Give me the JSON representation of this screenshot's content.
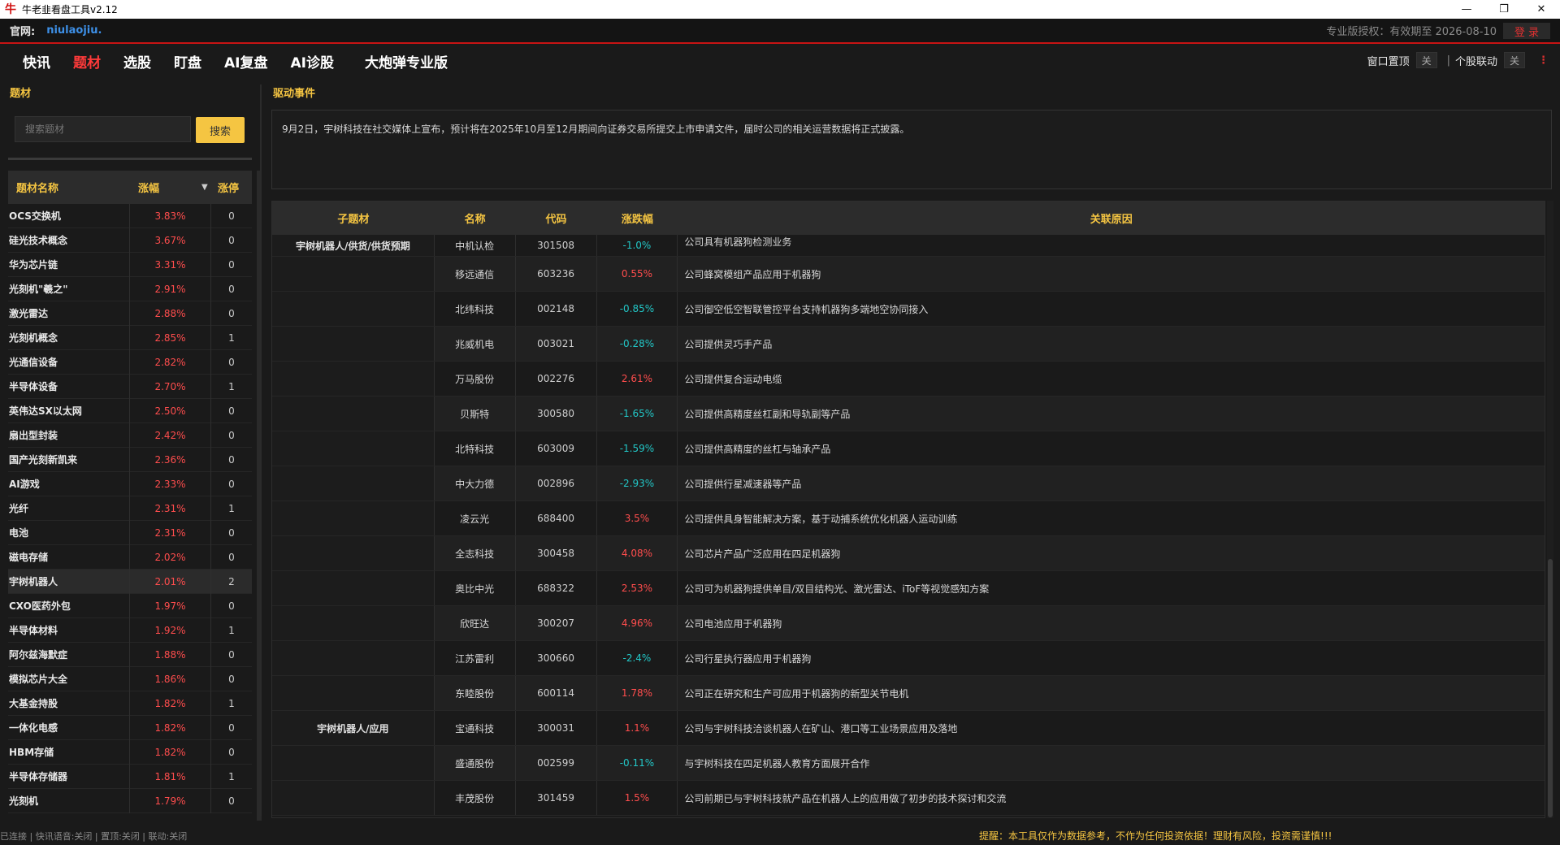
{
  "window": {
    "title": "牛老韭看盘工具v2.12",
    "app_icon": "牛"
  },
  "site": {
    "label": "官网:",
    "url": "niulaojiu.",
    "license": "专业版授权：有效期至 2026-08-10",
    "login": "登 录"
  },
  "nav": {
    "tabs": [
      "快讯",
      "题材",
      "选股",
      "盯盘",
      "AI复盘",
      "AI诊股",
      "大炮弹专业版"
    ],
    "active_index": 1,
    "window_top_label": "窗口置顶",
    "window_top_state": "关",
    "separator": "|",
    "stock_link_label": "个股联动",
    "stock_link_state": "关"
  },
  "left": {
    "header": "题材",
    "search_placeholder": "搜索题材",
    "search_button": "搜索",
    "columns": [
      "题材名称",
      "涨幅",
      "涨停"
    ],
    "sort_icon": "▼",
    "selected_index": 15,
    "rows": [
      {
        "name": "OCS交换机",
        "change": "3.83%",
        "limit_up": "0"
      },
      {
        "name": "硅光技术概念",
        "change": "3.67%",
        "limit_up": "0"
      },
      {
        "name": "华为芯片链",
        "change": "3.31%",
        "limit_up": "0"
      },
      {
        "name": "光刻机\"羲之\"",
        "change": "2.91%",
        "limit_up": "0"
      },
      {
        "name": "激光雷达",
        "change": "2.88%",
        "limit_up": "0"
      },
      {
        "name": "光刻机概念",
        "change": "2.85%",
        "limit_up": "1"
      },
      {
        "name": "光通信设备",
        "change": "2.82%",
        "limit_up": "0"
      },
      {
        "name": "半导体设备",
        "change": "2.70%",
        "limit_up": "1"
      },
      {
        "name": "英伟达SX以太网",
        "change": "2.50%",
        "limit_up": "0"
      },
      {
        "name": "扇出型封装",
        "change": "2.42%",
        "limit_up": "0"
      },
      {
        "name": "国产光刻新凯来",
        "change": "2.36%",
        "limit_up": "0"
      },
      {
        "name": "AI游戏",
        "change": "2.33%",
        "limit_up": "0"
      },
      {
        "name": "光纤",
        "change": "2.31%",
        "limit_up": "1"
      },
      {
        "name": "电池",
        "change": "2.31%",
        "limit_up": "0"
      },
      {
        "name": "磁电存储",
        "change": "2.02%",
        "limit_up": "0"
      },
      {
        "name": "宇树机器人",
        "change": "2.01%",
        "limit_up": "2"
      },
      {
        "name": "CXO医药外包",
        "change": "1.97%",
        "limit_up": "0"
      },
      {
        "name": "半导体材料",
        "change": "1.92%",
        "limit_up": "1"
      },
      {
        "name": "阿尔兹海默症",
        "change": "1.88%",
        "limit_up": "0"
      },
      {
        "name": "模拟芯片大全",
        "change": "1.86%",
        "limit_up": "0"
      },
      {
        "name": "大基金持股",
        "change": "1.82%",
        "limit_up": "1"
      },
      {
        "name": "一体化电感",
        "change": "1.82%",
        "limit_up": "0"
      },
      {
        "name": "HBM存储",
        "change": "1.82%",
        "limit_up": "0"
      },
      {
        "name": "半导体存储器",
        "change": "1.81%",
        "limit_up": "1"
      },
      {
        "name": "光刻机",
        "change": "1.79%",
        "limit_up": "0"
      }
    ]
  },
  "right": {
    "header": "驱动事件",
    "event_text": "9月2日，宇树科技在社交媒体上宣布，预计将在2025年10月至12月期间向证券交易所提交上市申请文件，届时公司的相关运营数据将正式披露。",
    "columns": [
      "子题材",
      "名称",
      "代码",
      "涨跌幅",
      "关联原因"
    ],
    "rows": [
      {
        "sub": "宇树机器人/供货/供货预期",
        "name": "中机认检",
        "code": "301508",
        "change": "-1.0%",
        "dir": "down",
        "reason": "公司具有机器狗检测业务"
      },
      {
        "sub": "",
        "name": "移远通信",
        "code": "603236",
        "change": "0.55%",
        "dir": "up",
        "reason": "公司蜂窝模组产品应用于机器狗"
      },
      {
        "sub": "",
        "name": "北纬科技",
        "code": "002148",
        "change": "-0.85%",
        "dir": "down",
        "reason": "公司御空低空智联管控平台支持机器狗多端地空协同接入"
      },
      {
        "sub": "",
        "name": "兆威机电",
        "code": "003021",
        "change": "-0.28%",
        "dir": "down",
        "reason": "公司提供灵巧手产品"
      },
      {
        "sub": "",
        "name": "万马股份",
        "code": "002276",
        "change": "2.61%",
        "dir": "up",
        "reason": "公司提供复合运动电缆"
      },
      {
        "sub": "",
        "name": "贝斯特",
        "code": "300580",
        "change": "-1.65%",
        "dir": "down",
        "reason": "公司提供高精度丝杠副和导轨副等产品"
      },
      {
        "sub": "",
        "name": "北特科技",
        "code": "603009",
        "change": "-1.59%",
        "dir": "down",
        "reason": "公司提供高精度的丝杠与轴承产品"
      },
      {
        "sub": "",
        "name": "中大力德",
        "code": "002896",
        "change": "-2.93%",
        "dir": "down",
        "reason": "公司提供行星减速器等产品"
      },
      {
        "sub": "",
        "name": "凌云光",
        "code": "688400",
        "change": "3.5%",
        "dir": "up",
        "reason": "公司提供具身智能解决方案，基于动捕系统优化机器人运动训练"
      },
      {
        "sub": "",
        "name": "全志科技",
        "code": "300458",
        "change": "4.08%",
        "dir": "up",
        "reason": "公司芯片产品广泛应用在四足机器狗"
      },
      {
        "sub": "",
        "name": "奥比中光",
        "code": "688322",
        "change": "2.53%",
        "dir": "up",
        "reason": "公司可为机器狗提供单目/双目结构光、激光雷达、iToF等视觉感知方案"
      },
      {
        "sub": "",
        "name": "欣旺达",
        "code": "300207",
        "change": "4.96%",
        "dir": "up",
        "reason": "公司电池应用于机器狗"
      },
      {
        "sub": "",
        "name": "江苏雷利",
        "code": "300660",
        "change": "-2.4%",
        "dir": "down",
        "reason": "公司行星执行器应用于机器狗"
      },
      {
        "sub": "",
        "name": "东睦股份",
        "code": "600114",
        "change": "1.78%",
        "dir": "up",
        "reason": "公司正在研究和生产可应用于机器狗的新型关节电机"
      },
      {
        "sub": "宇树机器人/应用",
        "name": "宝通科技",
        "code": "300031",
        "change": "1.1%",
        "dir": "up",
        "reason": "公司与宇树科技洽谈机器人在矿山、港口等工业场景应用及落地"
      },
      {
        "sub": "",
        "name": "盛通股份",
        "code": "002599",
        "change": "-0.11%",
        "dir": "down",
        "reason": "与宇树科技在四足机器人教育方面展开合作"
      },
      {
        "sub": "",
        "name": "丰茂股份",
        "code": "301459",
        "change": "1.5%",
        "dir": "up",
        "reason": "公司前期已与宇树科技就产品在机器人上的应用做了初步的技术探讨和交流"
      }
    ]
  },
  "status": {
    "text": "已连接 | 快讯语音:关闭 | 置顶:关闭 | 联动:关闭",
    "warning": "提醒：本工具仅作为数据参考，不作为任何投资依据！理财有风险，投资需谨慎!!!"
  },
  "colors": {
    "up": "#ff4d4d",
    "down": "#22c7c7",
    "accent": "#f5c542",
    "brand_red": "#c81414"
  }
}
